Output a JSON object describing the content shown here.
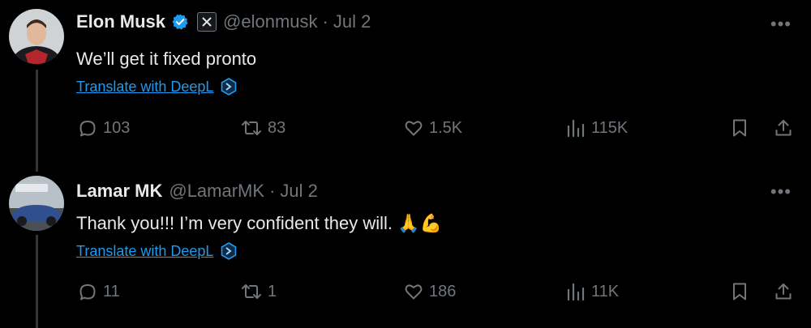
{
  "tweets": [
    {
      "display_name": "Elon Musk",
      "handle": "@elonmusk",
      "separator": "·",
      "date": "Jul 2",
      "more": "•••",
      "text": "We’ll get it fixed pronto",
      "translate": "Translate with DeepL",
      "replies": "103",
      "retweets": "83",
      "likes": "1.5K",
      "views": "115K",
      "verified_color": "#1d9bf0"
    },
    {
      "display_name": "Lamar MK",
      "handle": "@LamarMK",
      "separator": "·",
      "date": "Jul 2",
      "more": "•••",
      "text": "Thank you!!! I’m very confident they will.",
      "emojis": "🙏💪",
      "translate": "Translate with DeepL",
      "replies": "11",
      "retweets": "1",
      "likes": "186",
      "views": "11K"
    }
  ],
  "icons": {
    "reply": "reply-icon",
    "retweet": "retweet-icon",
    "like": "heart-icon",
    "views": "views-icon",
    "bookmark": "bookmark-icon",
    "share": "share-icon",
    "deepl": "deepl-icon",
    "verified": "verified-badge-icon",
    "affiliate": "x-logo-icon"
  },
  "colors": {
    "background": "#000000",
    "text": "#e7e9ea",
    "muted": "#71767b",
    "link": "#1d9bf0",
    "thread_line": "#333639"
  }
}
